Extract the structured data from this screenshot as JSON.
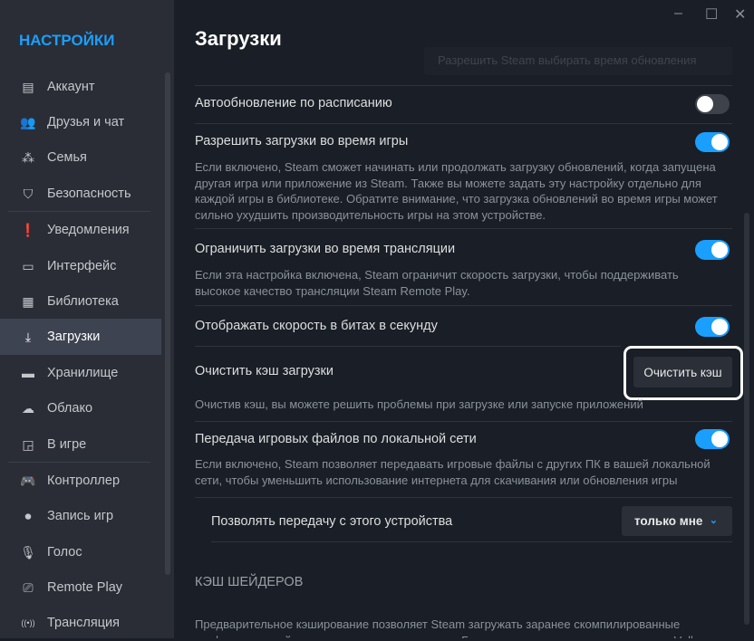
{
  "sidebar": {
    "title": "НАСТРОЙКИ",
    "items": [
      {
        "label": "Аккаунт",
        "icon": "account-card-icon"
      },
      {
        "label": "Друзья и чат",
        "icon": "friends-icon"
      },
      {
        "label": "Семья",
        "icon": "family-icon"
      },
      {
        "label": "Безопасность",
        "icon": "shield-icon"
      },
      {
        "label": "Уведомления",
        "icon": "alert-icon"
      },
      {
        "label": "Интерфейс",
        "icon": "monitor-icon"
      },
      {
        "label": "Библиотека",
        "icon": "grid-icon"
      },
      {
        "label": "Загрузки",
        "icon": "download-icon"
      },
      {
        "label": "Хранилище",
        "icon": "drive-icon"
      },
      {
        "label": "Облако",
        "icon": "cloud-icon"
      },
      {
        "label": "В игре",
        "icon": "ingame-icon"
      },
      {
        "label": "Контроллер",
        "icon": "gamepad-icon"
      },
      {
        "label": "Запись игр",
        "icon": "rec-icon"
      },
      {
        "label": "Голос",
        "icon": "microphone-icon"
      },
      {
        "label": "Remote Play",
        "icon": "cast-icon"
      },
      {
        "label": "Трансляция",
        "icon": "broadcast-icon"
      }
    ],
    "active": "Загрузки"
  },
  "window": {
    "minimize": "–",
    "maximize": "☐",
    "close": "✕"
  },
  "main": {
    "title": "Загрузки",
    "faded_dropdown": "Разрешить Steam выбирать время обновления",
    "auto_update": {
      "label": "Автообновление по расписанию",
      "on": false
    },
    "allow_during_game": {
      "label": "Разрешить загрузки во время игры",
      "on": true,
      "desc": "Если включено, Steam сможет начинать или продолжать загрузку обновлений, когда запущена другая игра или приложение из Steam. Также вы можете задать эту настройку отдельно для каждой игры в библиотеке. Обратите внимание, что загрузка обновлений во время игры может сильно ухудшить производительность игры на этом устройстве."
    },
    "throttle_streaming": {
      "label": "Ограничить загрузки во время трансляции",
      "on": true,
      "desc": "Если эта настройка включена, Steam ограничит скорость загрузки, чтобы поддерживать высокое качество трансляции Steam Remote Play."
    },
    "bits_per_second": {
      "label": "Отображать скорость в битах в секунду",
      "on": true
    },
    "clear_cache": {
      "label": "Очистить кэш загрузки",
      "button": "Очистить кэш",
      "desc": "Очистив кэш, вы можете решить проблемы при загрузке или запуске приложений"
    },
    "lan_transfer": {
      "label": "Передача игровых файлов по локальной сети",
      "on": true,
      "desc": "Если включено, Steam позволяет передавать игровые файлы с других ПК в вашей локальной сети, чтобы уменьшить использование интернета для скачивания или обновления игры"
    },
    "allow_from_device": {
      "label": "Позволять передачу с этого устройства",
      "value": "только мне"
    },
    "shader_section": "КЭШ ШЕЙДЕРОВ",
    "shader_desc": "Предварительное кэширование позволяет Steam загружать заранее скомпилированные графические шейдеры для вашего компьютера. Благодаря этому игры, использующие Vulkan или"
  }
}
